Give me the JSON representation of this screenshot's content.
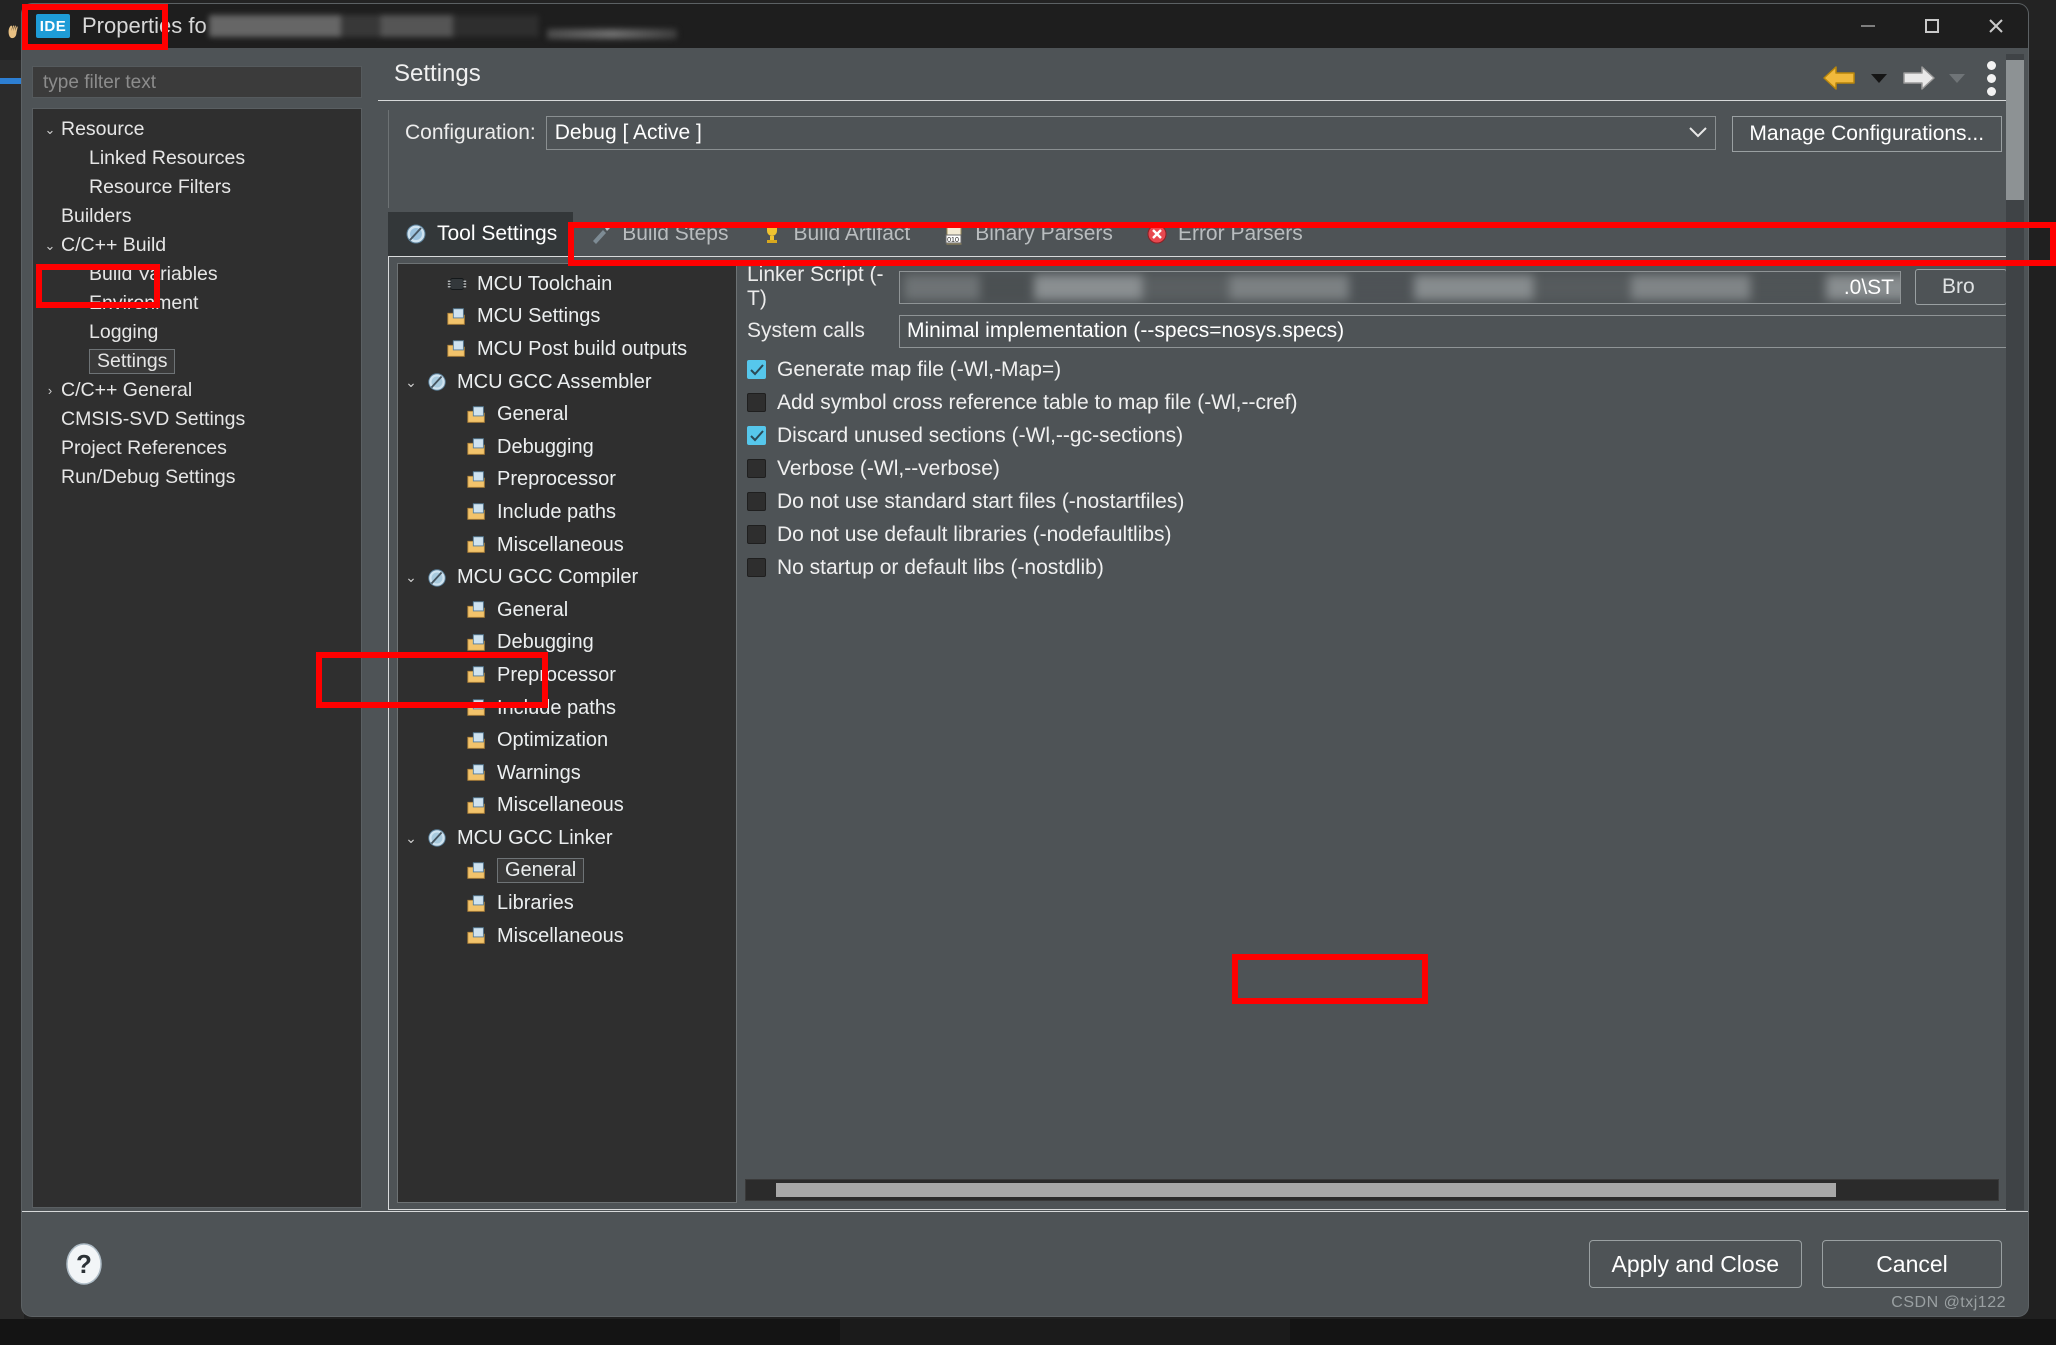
{
  "window": {
    "badge": "IDE",
    "title": "Properties fo",
    "buttons": {
      "minimize": "minimize-icon",
      "maximize": "maximize-icon",
      "close": "close-icon"
    }
  },
  "filter": {
    "placeholder": "type filter text",
    "value": ""
  },
  "nav_tree": [
    {
      "label": "Resource",
      "indent": 0,
      "twisty": "⌄",
      "selected": false
    },
    {
      "label": "Linked Resources",
      "indent": 1,
      "twisty": "",
      "selected": false
    },
    {
      "label": "Resource Filters",
      "indent": 1,
      "twisty": "",
      "selected": false
    },
    {
      "label": "Builders",
      "indent": 0,
      "twisty": "",
      "selected": false
    },
    {
      "label": "C/C++ Build",
      "indent": 0,
      "twisty": "⌄",
      "selected": false
    },
    {
      "label": "Build Variables",
      "indent": 1,
      "twisty": "",
      "selected": false
    },
    {
      "label": "Environment",
      "indent": 1,
      "twisty": "",
      "selected": false
    },
    {
      "label": "Logging",
      "indent": 1,
      "twisty": "",
      "selected": false
    },
    {
      "label": "Settings",
      "indent": 1,
      "twisty": "",
      "selected": true
    },
    {
      "label": "C/C++ General",
      "indent": 0,
      "twisty": "›",
      "selected": false
    },
    {
      "label": "CMSIS-SVD Settings",
      "indent": 0,
      "twisty": "",
      "selected": false
    },
    {
      "label": "Project References",
      "indent": 0,
      "twisty": "",
      "selected": false
    },
    {
      "label": "Run/Debug Settings",
      "indent": 0,
      "twisty": "",
      "selected": false
    }
  ],
  "pane": {
    "title": "Settings",
    "nav": {
      "back": "back-arrow-icon",
      "back_caret": "back-dropdown-caret",
      "forward": "forward-arrow-icon",
      "forward_caret": "forward-dropdown-caret",
      "menu": "view-menu-icon"
    }
  },
  "configuration": {
    "label": "Configuration:",
    "value": "Debug  [ Active ]",
    "chevron": "chevron-down-icon",
    "manage_button": "Manage Configurations..."
  },
  "tabs": [
    {
      "label": "Tool Settings",
      "icon": "tool-settings-icon",
      "active": true
    },
    {
      "label": "Build Steps",
      "icon": "build-steps-icon",
      "active": false
    },
    {
      "label": "Build Artifact",
      "icon": "build-artifact-icon",
      "active": false
    },
    {
      "label": "Binary Parsers",
      "icon": "binary-parsers-icon",
      "active": false
    },
    {
      "label": "Error Parsers",
      "icon": "error-parsers-icon",
      "active": false
    }
  ],
  "tool_tree": [
    {
      "label": "MCU Toolchain",
      "indent": 1,
      "twisty": "",
      "icon": "chip-icon",
      "selected": false
    },
    {
      "label": "MCU Settings",
      "indent": 1,
      "twisty": "",
      "icon": "folder-icon",
      "selected": false
    },
    {
      "label": "MCU Post build outputs",
      "indent": 1,
      "twisty": "",
      "icon": "folder-icon",
      "selected": false
    },
    {
      "label": "MCU GCC Assembler",
      "indent": 0,
      "twisty": "⌄",
      "icon": "tool-icon",
      "selected": false
    },
    {
      "label": "General",
      "indent": 2,
      "twisty": "",
      "icon": "folder-icon",
      "selected": false
    },
    {
      "label": "Debugging",
      "indent": 2,
      "twisty": "",
      "icon": "folder-icon",
      "selected": false
    },
    {
      "label": "Preprocessor",
      "indent": 2,
      "twisty": "",
      "icon": "folder-icon",
      "selected": false
    },
    {
      "label": "Include paths",
      "indent": 2,
      "twisty": "",
      "icon": "folder-icon",
      "selected": false
    },
    {
      "label": "Miscellaneous",
      "indent": 2,
      "twisty": "",
      "icon": "folder-icon",
      "selected": false
    },
    {
      "label": "MCU GCC Compiler",
      "indent": 0,
      "twisty": "⌄",
      "icon": "tool-icon",
      "selected": false
    },
    {
      "label": "General",
      "indent": 2,
      "twisty": "",
      "icon": "folder-icon",
      "selected": false
    },
    {
      "label": "Debugging",
      "indent": 2,
      "twisty": "",
      "icon": "folder-icon",
      "selected": false
    },
    {
      "label": "Preprocessor",
      "indent": 2,
      "twisty": "",
      "icon": "folder-icon",
      "selected": false
    },
    {
      "label": "Include paths",
      "indent": 2,
      "twisty": "",
      "icon": "folder-icon",
      "selected": false
    },
    {
      "label": "Optimization",
      "indent": 2,
      "twisty": "",
      "icon": "folder-icon",
      "selected": false
    },
    {
      "label": "Warnings",
      "indent": 2,
      "twisty": "",
      "icon": "folder-icon",
      "selected": false
    },
    {
      "label": "Miscellaneous",
      "indent": 2,
      "twisty": "",
      "icon": "folder-icon",
      "selected": false
    },
    {
      "label": "MCU GCC Linker",
      "indent": 0,
      "twisty": "⌄",
      "icon": "tool-icon",
      "selected": false
    },
    {
      "label": "General",
      "indent": 2,
      "twisty": "",
      "icon": "folder-icon",
      "selected": true
    },
    {
      "label": "Libraries",
      "indent": 2,
      "twisty": "",
      "icon": "folder-icon",
      "selected": false
    },
    {
      "label": "Miscellaneous",
      "indent": 2,
      "twisty": "",
      "icon": "folder-icon",
      "selected": false
    }
  ],
  "linker": {
    "script_label": "Linker Script (-T)",
    "script_value_tail": ".0\\ST",
    "browse_label": "Bro",
    "system_calls_label": "System calls",
    "system_calls_value": "Minimal implementation (--specs=nosys.specs)",
    "options": [
      {
        "label": "Generate map file (-Wl,-Map=)",
        "checked": true
      },
      {
        "label": "Add symbol cross reference table to map file (-Wl,--cref)",
        "checked": false
      },
      {
        "label": "Discard unused sections (-Wl,--gc-sections)",
        "checked": true
      },
      {
        "label": "Verbose (-Wl,--verbose)",
        "checked": false
      },
      {
        "label": "Do not use standard start files (-nostartfiles)",
        "checked": false
      },
      {
        "label": "Do not use default libraries (-nodefaultlibs)",
        "checked": false
      },
      {
        "label": "No startup or default libs (-nostdlib)",
        "checked": false
      }
    ]
  },
  "footer": {
    "help": "help-icon",
    "apply_label": "Apply and Close",
    "cancel_label": "Cancel",
    "watermark": "CSDN @txj122"
  },
  "colors": {
    "annotation": "#ff0000",
    "accent_checkbox": "#56c7ec",
    "dialog_bg": "#4e5356",
    "tree_bg": "#2f2f2f"
  }
}
